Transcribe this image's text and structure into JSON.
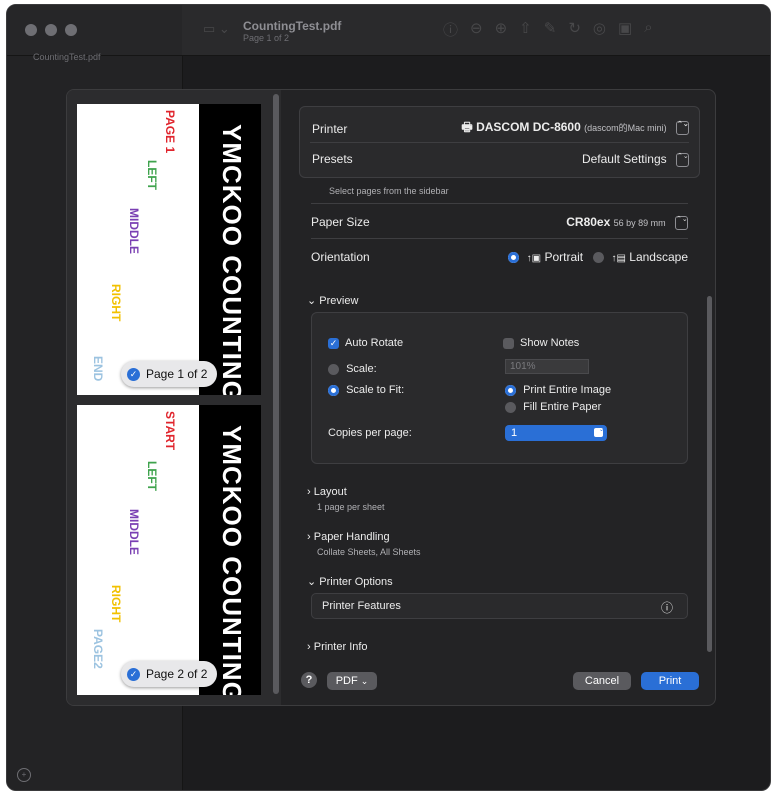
{
  "window": {
    "title": "CountingTest.pdf",
    "subtitle": "Page 1 of 2",
    "sidebar_file": "CountingTest.pdf"
  },
  "toolbar_icons": [
    "sidebar-icon",
    "info-icon",
    "zoom-out-icon",
    "zoom-in-icon",
    "share-icon",
    "markup-icon",
    "rotate-icon",
    "highlight-icon",
    "redact-icon",
    "search-icon"
  ],
  "preview": {
    "pages": [
      {
        "big": "YMCKOO COUNTING",
        "top": "PAGE 1",
        "left": "LEFT",
        "middle": "MIDDLE",
        "right": "RIGHT",
        "end": "END",
        "badge": "Page 1 of 2"
      },
      {
        "big": "YMCKOO COUNTING",
        "top": "START",
        "left": "LEFT",
        "middle": "MIDDLE",
        "right": "RIGHT",
        "end": "PAGE2",
        "badge": "Page 2 of 2"
      }
    ]
  },
  "printer": {
    "label": "Printer",
    "value": "DASCOM DC-8600",
    "value_sub": "(dascom的Mac mini)",
    "presets_label": "Presets",
    "presets_value": "Default Settings",
    "select_hint": "Select pages from the sidebar",
    "paper_label": "Paper Size",
    "paper_value": "CR80ex",
    "paper_dims": "56 by 89 mm",
    "orientation_label": "Orientation",
    "portrait": "Portrait",
    "landscape": "Landscape"
  },
  "preview_section": {
    "header": "Preview",
    "auto_rotate": "Auto Rotate",
    "show_notes": "Show Notes",
    "scale_label": "Scale:",
    "scale_value": "101%",
    "scale_to_fit": "Scale to Fit:",
    "print_entire": "Print Entire Image",
    "fill_paper": "Fill Entire Paper",
    "copies_label": "Copies per page:",
    "copies_value": "1"
  },
  "sections": {
    "layout": "Layout",
    "layout_sub": "1 page per sheet",
    "paper_handling": "Paper Handling",
    "paper_handling_sub": "Collate Sheets, All Sheets",
    "printer_options": "Printer Options",
    "printer_features": "Printer Features",
    "printer_info": "Printer Info"
  },
  "footer": {
    "help": "?",
    "pdf": "PDF",
    "cancel": "Cancel",
    "print": "Print"
  },
  "colors": {
    "accent": "#2a6fd6",
    "red": "#e0242c",
    "green": "#3fa34d",
    "purple": "#7a3fb3",
    "yellow": "#f2c100",
    "lightblue": "#9cc3e0"
  }
}
